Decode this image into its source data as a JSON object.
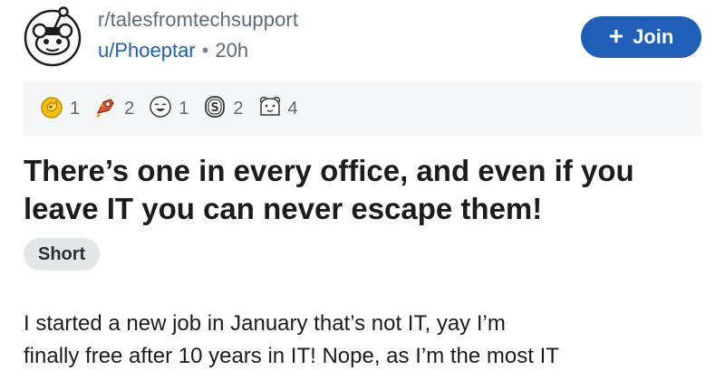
{
  "post": {
    "subreddit": "r/talesfromtechsupport",
    "author": "u/Phoeptar",
    "separator": "•",
    "age": "20h",
    "join_label": "Join",
    "title_line1": "There’s one in every office, and even if you",
    "title_line2": "leave IT you can never escape them!",
    "flair": "Short",
    "body_line1": "I started a new job in January that’s not IT, yay I’m",
    "body_line2": "finally free after 10 years in IT! Nope, as I’m the most IT"
  },
  "awards": [
    {
      "icon": "gold-award-icon",
      "count": "1"
    },
    {
      "icon": "rocket-like-award-icon",
      "count": "2"
    },
    {
      "icon": "laughing-face-award-icon",
      "count": "1"
    },
    {
      "icon": "silver-coin-award-icon",
      "count": "2"
    },
    {
      "icon": "bear-face-award-icon",
      "count": "4"
    }
  ],
  "colors": {
    "accent": "#1f5fb8",
    "username": "#1f5fad",
    "muted_text": "#5f6a72",
    "awards_bg": "#f5f6f7",
    "flair_bg": "#e4e6e8"
  }
}
